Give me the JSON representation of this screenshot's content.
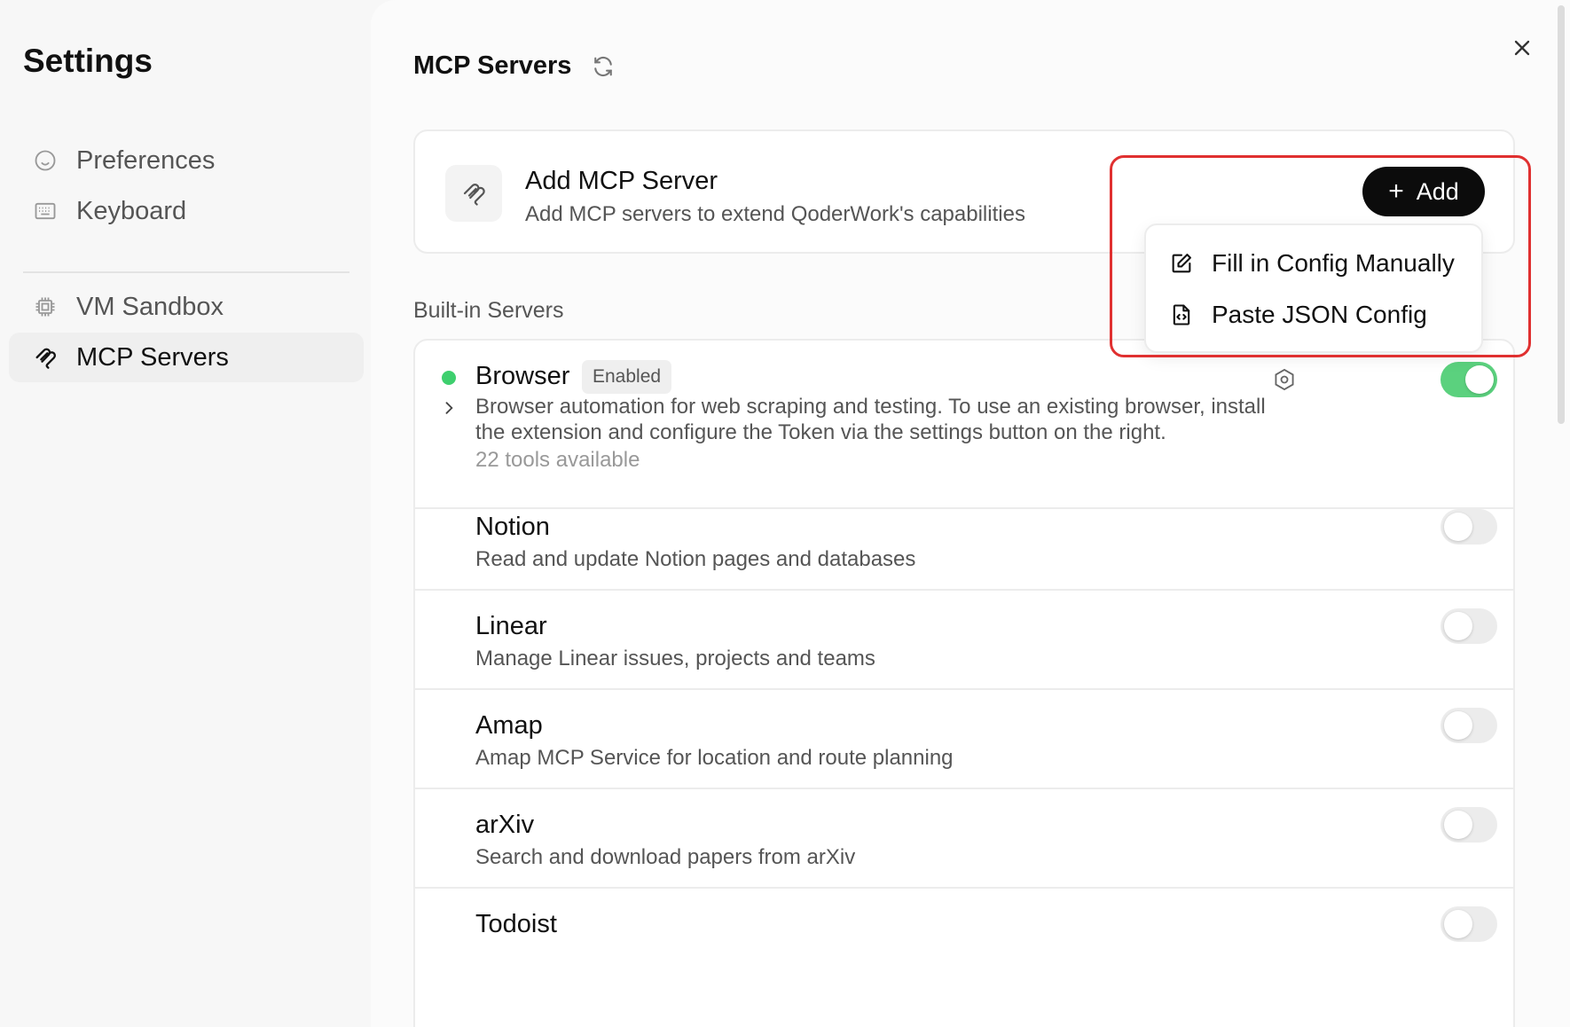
{
  "sidebar": {
    "title": "Settings",
    "items": [
      {
        "label": "Preferences",
        "icon": "smiley-icon"
      },
      {
        "label": "Keyboard",
        "icon": "keyboard-icon"
      },
      {
        "label": "VM Sandbox",
        "icon": "chip-icon"
      },
      {
        "label": "MCP Servers",
        "icon": "mcp-icon",
        "active": true
      }
    ]
  },
  "header": {
    "title": "MCP Servers"
  },
  "add_card": {
    "title": "Add MCP Server",
    "subtitle": "Add MCP servers to extend QoderWork's capabilities",
    "add_label": "Add"
  },
  "dropdown": {
    "items": [
      {
        "label": "Fill in Config Manually",
        "icon": "edit-icon"
      },
      {
        "label": "Paste JSON Config",
        "icon": "json-file-icon"
      }
    ]
  },
  "builtin": {
    "label": "Built-in Servers",
    "servers": [
      {
        "name": "Browser",
        "badge": "Enabled",
        "description_line1": "Browser automation for web scraping and testing. To use an existing browser, install",
        "description_line2": "the extension and configure the Token via the settings button on the right.",
        "tools": "22 tools available",
        "enabled": true
      },
      {
        "name": "Notion",
        "description": "Read and update Notion pages and databases",
        "enabled": false
      },
      {
        "name": "Linear",
        "description": "Manage Linear issues, projects and teams",
        "enabled": false
      },
      {
        "name": "Amap",
        "description": "Amap MCP Service for location and route planning",
        "enabled": false
      },
      {
        "name": "arXiv",
        "description": "Search and download papers from arXiv",
        "enabled": false
      },
      {
        "name": "Todoist",
        "description": "",
        "enabled": false
      }
    ]
  },
  "colors": {
    "accent_green": "#5bd17e",
    "highlight_red": "#e03030",
    "button_black": "#0c0c0c"
  }
}
